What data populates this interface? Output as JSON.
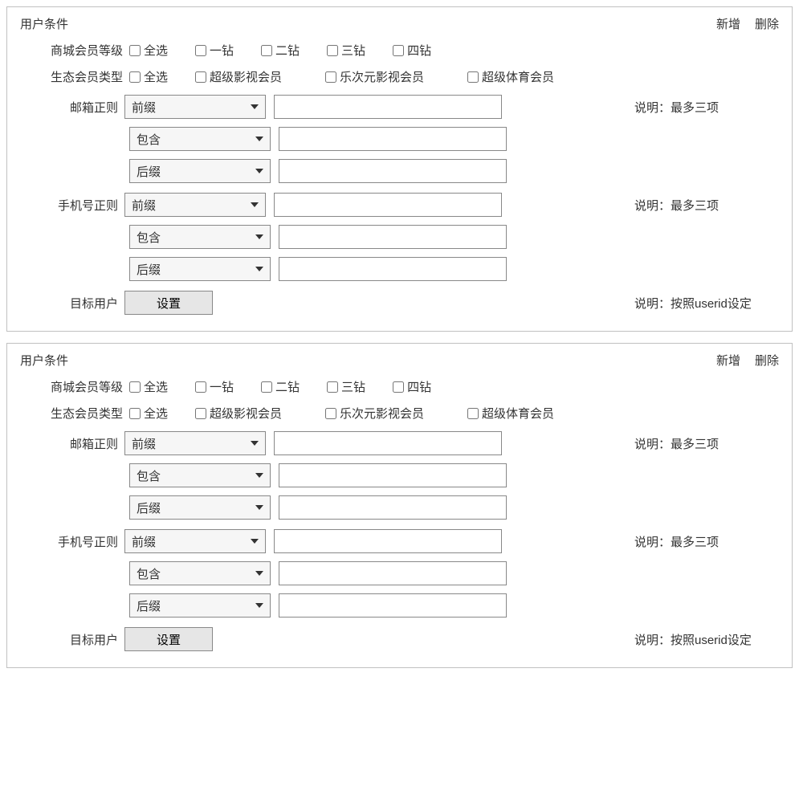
{
  "panels": [
    {
      "title": "用户条件",
      "actions": {
        "add": "新增",
        "delete": "删除"
      },
      "mall_level": {
        "label": "商城会员等级",
        "options": [
          "全选",
          "一钻",
          "二钻",
          "三钻",
          "四钻"
        ]
      },
      "eco_member": {
        "label": "生态会员类型",
        "options": [
          "全选",
          "超级影视会员",
          "乐次元影视会员",
          "超级体育会员"
        ]
      },
      "email_regex": {
        "label": "邮箱正则",
        "rows": [
          {
            "selectLabel": "前缀",
            "value": ""
          },
          {
            "selectLabel": "包含",
            "value": ""
          },
          {
            "selectLabel": "后缀",
            "value": ""
          }
        ],
        "hint": "说明：最多三项"
      },
      "phone_regex": {
        "label": "手机号正则",
        "rows": [
          {
            "selectLabel": "前缀",
            "value": ""
          },
          {
            "selectLabel": "包含",
            "value": ""
          },
          {
            "selectLabel": "后缀",
            "value": ""
          }
        ],
        "hint": "说明：最多三项"
      },
      "target_user": {
        "label": "目标用户",
        "button": "设置",
        "hint": "说明：按照userid设定"
      }
    },
    {
      "title": "用户条件",
      "actions": {
        "add": "新增",
        "delete": "删除"
      },
      "mall_level": {
        "label": "商城会员等级",
        "options": [
          "全选",
          "一钻",
          "二钻",
          "三钻",
          "四钻"
        ]
      },
      "eco_member": {
        "label": "生态会员类型",
        "options": [
          "全选",
          "超级影视会员",
          "乐次元影视会员",
          "超级体育会员"
        ]
      },
      "email_regex": {
        "label": "邮箱正则",
        "rows": [
          {
            "selectLabel": "前缀",
            "value": ""
          },
          {
            "selectLabel": "包含",
            "value": ""
          },
          {
            "selectLabel": "后缀",
            "value": ""
          }
        ],
        "hint": "说明：最多三项"
      },
      "phone_regex": {
        "label": "手机号正则",
        "rows": [
          {
            "selectLabel": "前缀",
            "value": ""
          },
          {
            "selectLabel": "包含",
            "value": ""
          },
          {
            "selectLabel": "后缀",
            "value": ""
          }
        ],
        "hint": "说明：最多三项"
      },
      "target_user": {
        "label": "目标用户",
        "button": "设置",
        "hint": "说明：按照userid设定"
      }
    }
  ]
}
